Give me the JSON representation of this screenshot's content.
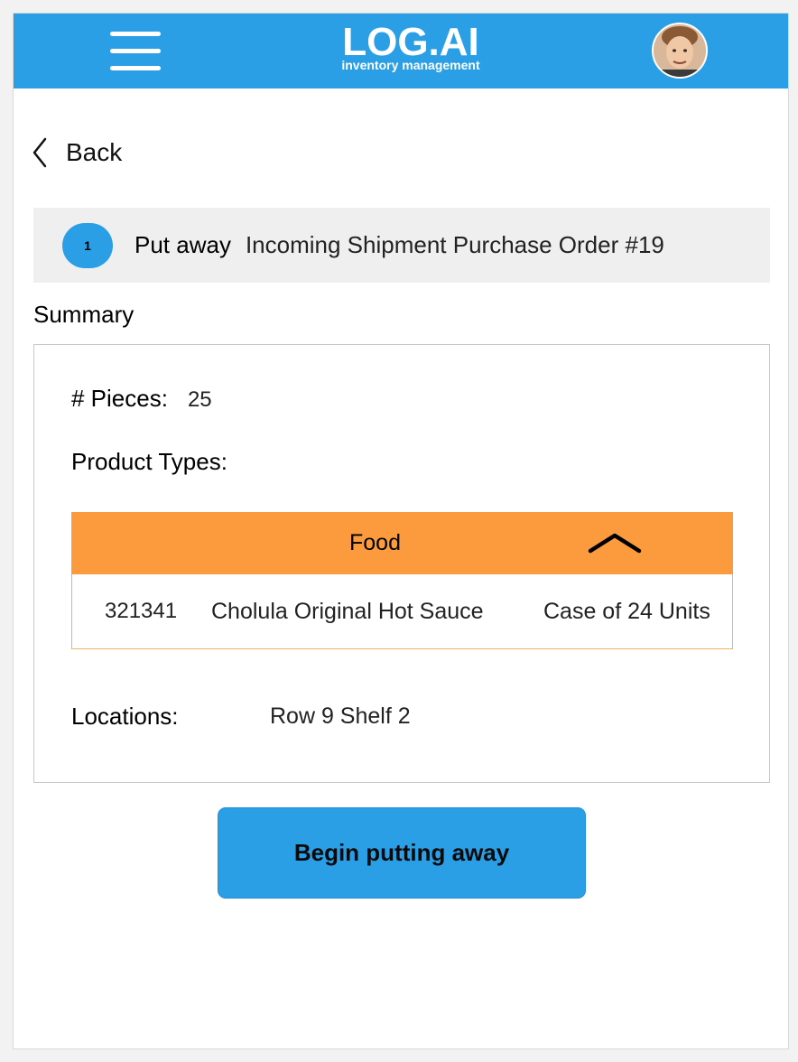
{
  "header": {
    "logo_title": "LOG.AI",
    "logo_subtitle": "inventory management",
    "menu_icon": "hamburger-menu-icon",
    "avatar_icon": "user-avatar",
    "bg_color": "#2a9fe6"
  },
  "nav": {
    "back_label": "Back",
    "back_icon": "chevron-left-icon"
  },
  "step": {
    "number": "1",
    "action": "Put away",
    "description": "Incoming Shipment Purchase Order #19"
  },
  "summary": {
    "title": "Summary",
    "pieces_label": "# Pieces:",
    "pieces_value": "25",
    "product_types_label": "Product Types:",
    "product_category": {
      "name": "Food",
      "expanded": true,
      "toggle_icon": "chevron-up-icon",
      "color": "#fb9b3d",
      "items": [
        {
          "sku": "321341",
          "name": "Cholula Original Hot Sauce",
          "unit": "Case of 24 Units"
        }
      ]
    },
    "locations_label": "Locations:",
    "locations_value": "Row 9 Shelf 2"
  },
  "actions": {
    "primary_label": "Begin putting away",
    "primary_color": "#2a9fe6"
  }
}
